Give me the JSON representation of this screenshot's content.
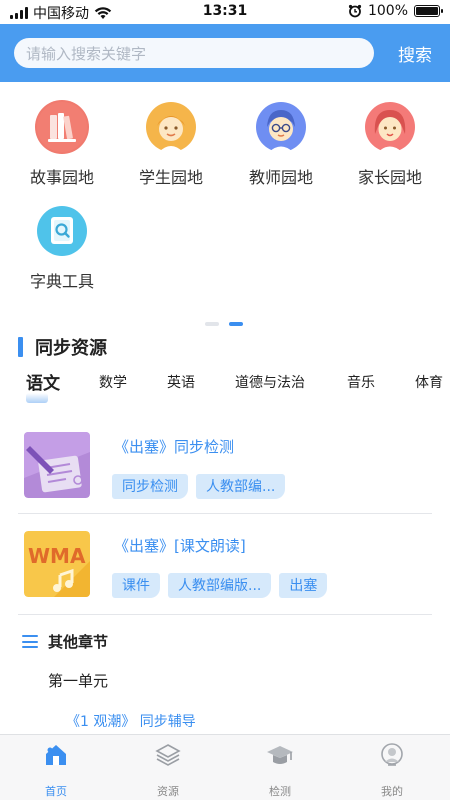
{
  "status_bar": {
    "carrier": "中国移动",
    "time": "13:31",
    "battery": "100%"
  },
  "search": {
    "placeholder": "请输入搜索关键字",
    "button": "搜索"
  },
  "categories": [
    {
      "label": "故事园地",
      "icon": "bookshelf-icon",
      "color": "#f07a6e"
    },
    {
      "label": "学生园地",
      "icon": "student-avatar-icon",
      "color": "#f5b54a"
    },
    {
      "label": "教师园地",
      "icon": "teacher-avatar-icon",
      "color": "#6f8ef2"
    },
    {
      "label": "家长园地",
      "icon": "parent-avatar-icon",
      "color": "#f47a78"
    },
    {
      "label": "字典工具",
      "icon": "dictionary-search-icon",
      "color": "#4fc3ea"
    }
  ],
  "carousel": {
    "page_count": 2,
    "active_page": 2
  },
  "section": {
    "title": "同步资源"
  },
  "tabs": [
    {
      "label": "语文",
      "active": true
    },
    {
      "label": "数学",
      "active": false
    },
    {
      "label": "英语",
      "active": false
    },
    {
      "label": "道德与法治",
      "active": false
    },
    {
      "label": "音乐",
      "active": false
    },
    {
      "label": "体育",
      "active": false
    }
  ],
  "resources": [
    {
      "title": "《出塞》同步检测",
      "thumb": "exam-paper-icon",
      "tags": [
        "同步检测",
        "人教部编..."
      ]
    },
    {
      "title": "《出塞》[课文朗读]",
      "thumb_text": "WMA",
      "thumb": "wma-audio-icon",
      "tags": [
        "课件",
        "人教部编版...",
        "出塞"
      ]
    }
  ],
  "other_chapters": {
    "title": "其他章节",
    "unit": "第一单元",
    "link": "《1 观潮》 同步辅导"
  },
  "bottom_nav": [
    {
      "label": "首页",
      "icon": "home-icon",
      "active": true
    },
    {
      "label": "资源",
      "icon": "layers-icon",
      "active": false
    },
    {
      "label": "检测",
      "icon": "graduation-cap-icon",
      "active": false
    },
    {
      "label": "我的",
      "icon": "user-icon",
      "active": false
    }
  ],
  "colors": {
    "accent": "#3b8ff0",
    "header": "#4a9cf0",
    "tag_bg": "#d6e9fb"
  }
}
